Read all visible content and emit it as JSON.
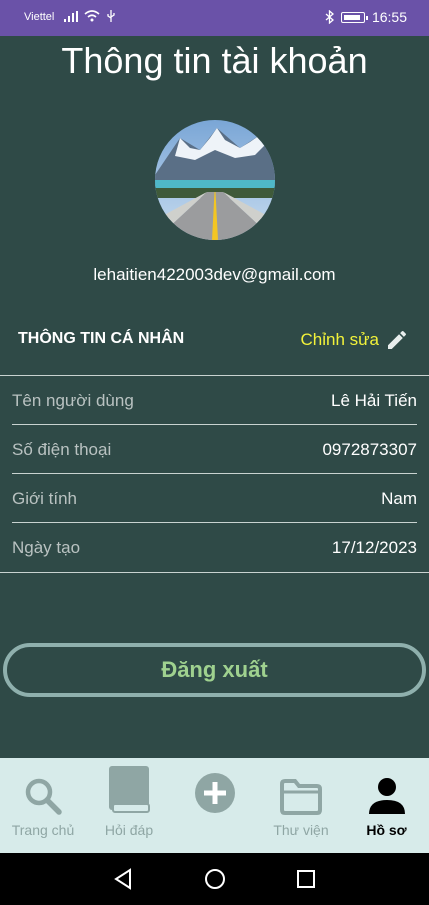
{
  "status_bar": {
    "carrier": "Viettel",
    "time": "16:55"
  },
  "header": {
    "title": "Thông tin tài khoản"
  },
  "profile": {
    "email": "lehaitien422003dev@gmail.com"
  },
  "personal": {
    "section_title": "THÔNG TIN CÁ NHÂN",
    "edit_label": "Chỉnh sửa",
    "rows": [
      {
        "label": "Tên người dùng",
        "value": "Lê Hải Tiến"
      },
      {
        "label": "Số điện thoại",
        "value": "0972873307"
      },
      {
        "label": "Giới tính",
        "value": "Nam"
      },
      {
        "label": "Ngày tạo",
        "value": "17/12/2023"
      }
    ]
  },
  "logout_label": "Đăng xuất",
  "bottom_nav": {
    "items": [
      {
        "label": "Trang chủ",
        "icon": "search-icon"
      },
      {
        "label": "Hỏi đáp",
        "icon": "book-icon"
      },
      {
        "label": "",
        "icon": "add-circle-icon"
      },
      {
        "label": "Thư viện",
        "icon": "folder-icon"
      },
      {
        "label": "Hồ sơ",
        "icon": "person-icon"
      }
    ],
    "active_index": 4
  },
  "colors": {
    "background": "#2f4a47",
    "status_bar": "#6a52a8",
    "accent_edit": "#f2f23a",
    "logout_text": "#9fd18f",
    "nav_background": "#d7ebea"
  }
}
